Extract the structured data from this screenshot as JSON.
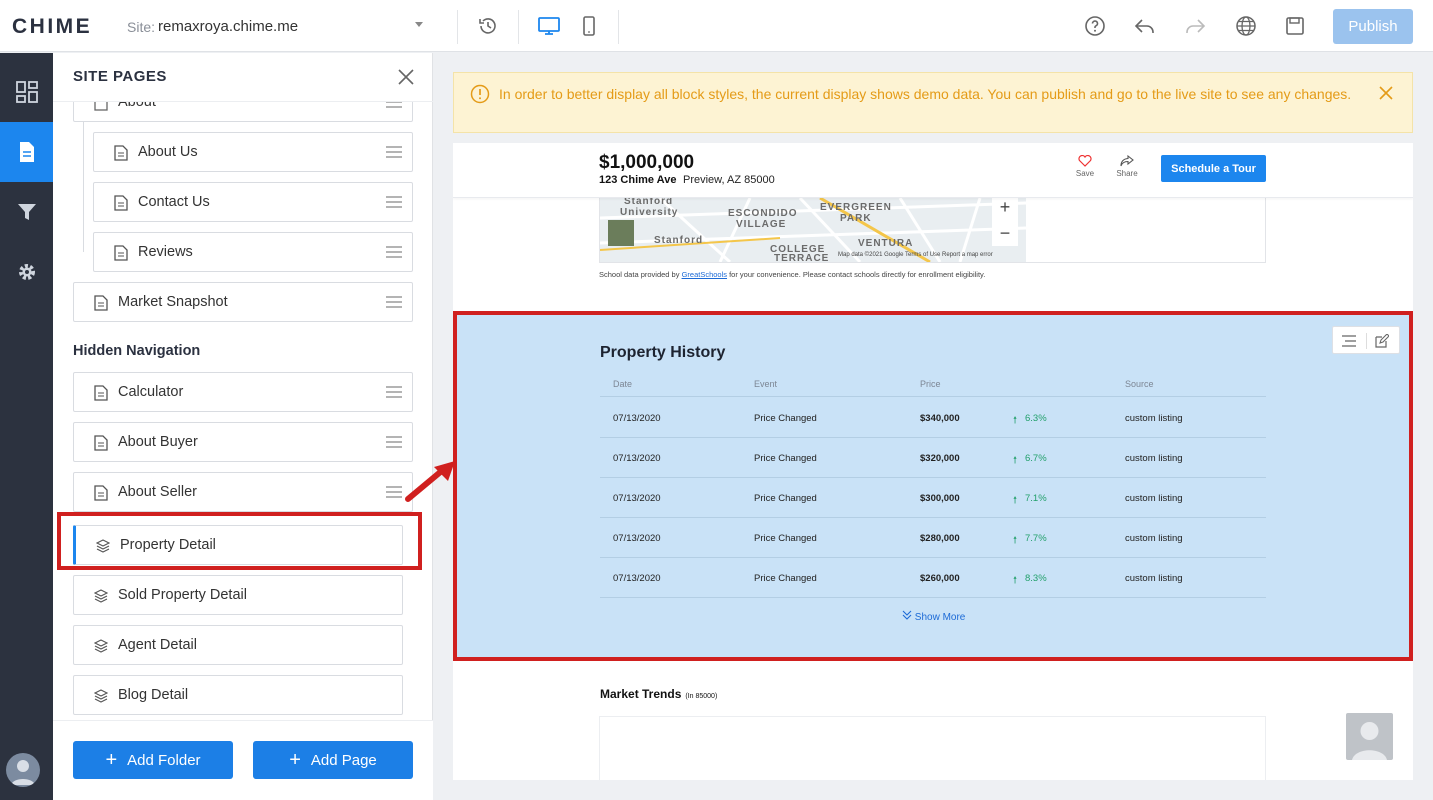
{
  "topbar": {
    "logo": "CHIME",
    "site_label": "Site:",
    "site_value": "remaxroya.chime.me",
    "publish_label": "Publish"
  },
  "panel": {
    "title": "SITE PAGES",
    "partial_item": "About",
    "children": [
      "About Us",
      "Contact Us",
      "Reviews"
    ],
    "market_snapshot": "Market Snapshot",
    "hidden_nav_title": "Hidden Navigation",
    "hidden_items": [
      "Calculator",
      "About Buyer",
      "About Seller"
    ],
    "templates": [
      "Property Detail",
      "Sold Property Detail",
      "Agent Detail",
      "Blog Detail"
    ],
    "add_folder": "Add Folder",
    "add_page": "Add Page"
  },
  "banner": {
    "text": "In order to better display all block styles, the current display shows demo data. You can publish and go to the live site to see any changes."
  },
  "listing": {
    "price": "$1,000,000",
    "address": "123 Chime Ave",
    "city": "Preview, AZ 85000",
    "save": "Save",
    "share": "Share",
    "tour_button": "Schedule a Tour"
  },
  "map": {
    "labels": [
      "Stanford",
      "University",
      "ESCONDIDO",
      "VILLAGE",
      "EVERGREEN",
      "PARK",
      "Stanford",
      "COLLEGE",
      "TERRACE",
      "VENTURA"
    ],
    "footer": "Map data ©2021 Google   Terms of Use   Report a map error",
    "school_prefix": "School data provided by ",
    "school_link": "GreatSchools",
    "school_suffix": " for your convenience. Please contact schools directly for enrollment eligibility."
  },
  "history": {
    "title": "Property History",
    "headers": [
      "Date",
      "Event",
      "Price",
      "Source"
    ],
    "rows": [
      {
        "date": "07/13/2020",
        "event": "Price Changed",
        "price": "$340,000",
        "change": "6.3%",
        "source": "custom listing"
      },
      {
        "date": "07/13/2020",
        "event": "Price Changed",
        "price": "$320,000",
        "change": "6.7%",
        "source": "custom listing"
      },
      {
        "date": "07/13/2020",
        "event": "Price Changed",
        "price": "$300,000",
        "change": "7.1%",
        "source": "custom listing"
      },
      {
        "date": "07/13/2020",
        "event": "Price Changed",
        "price": "$280,000",
        "change": "7.7%",
        "source": "custom listing"
      },
      {
        "date": "07/13/2020",
        "event": "Price Changed",
        "price": "$260,000",
        "change": "8.3%",
        "source": "custom listing"
      }
    ],
    "show_more": "Show More"
  },
  "trends": {
    "title": "Market Trends",
    "subtitle": "(In 85000)"
  },
  "colors": {
    "accent": "#1c86ee",
    "annotation_red": "#d0201f",
    "banner_text": "#e49b17",
    "up_green": "#22a06b"
  }
}
